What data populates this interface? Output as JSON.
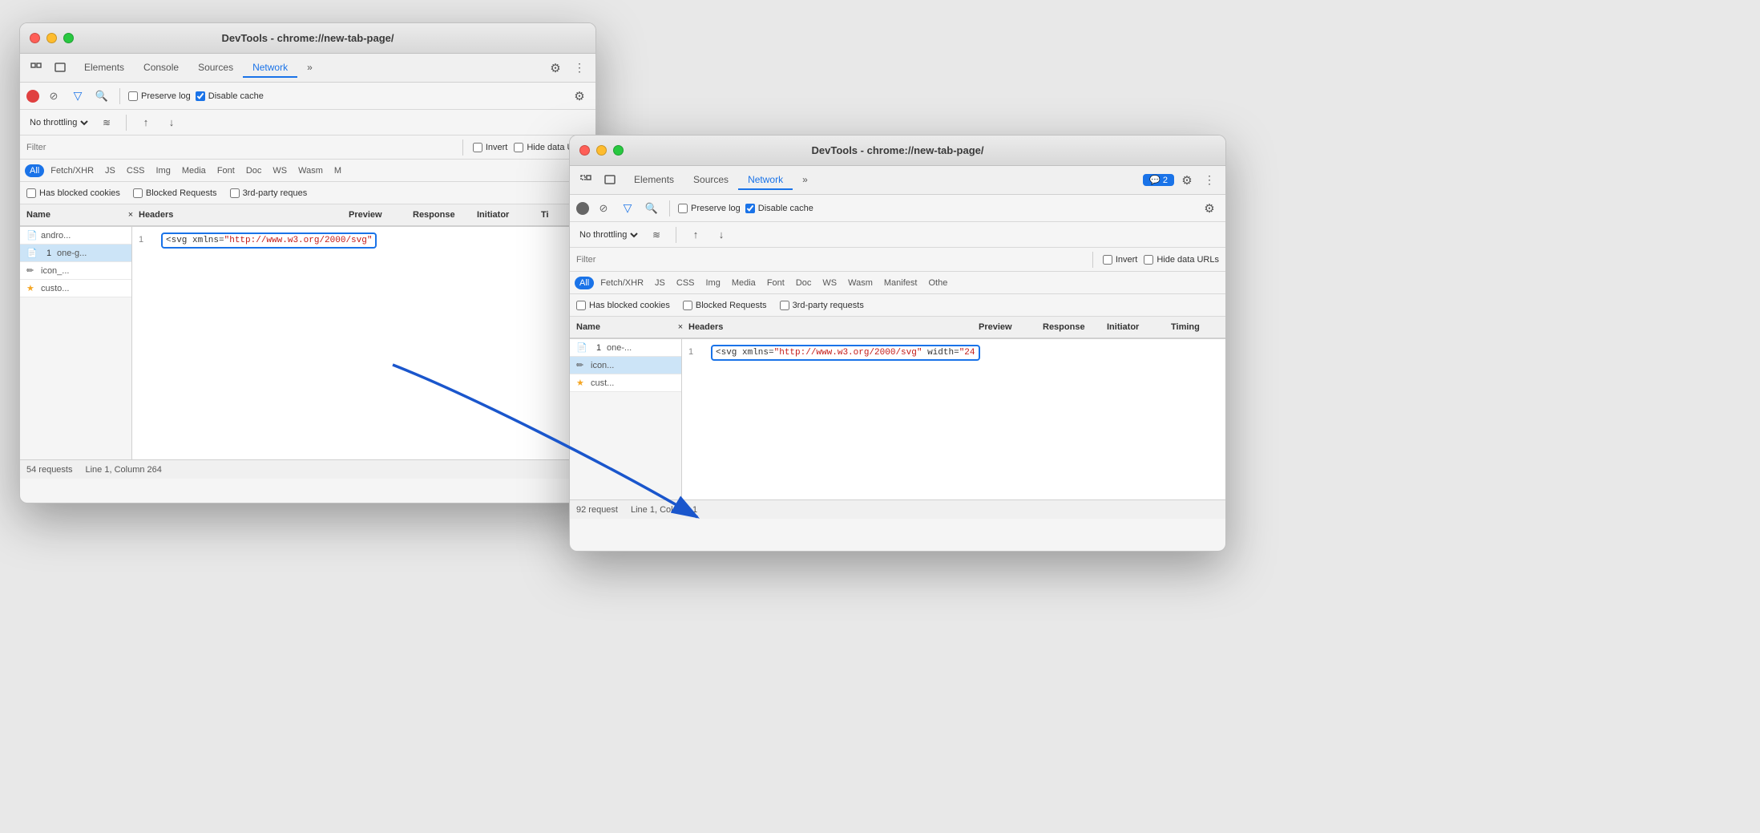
{
  "window1": {
    "title": "DevTools - chrome://new-tab-page/",
    "tabs": [
      {
        "label": "Elements",
        "active": false
      },
      {
        "label": "Console",
        "active": false
      },
      {
        "label": "Sources",
        "active": false
      },
      {
        "label": "Network",
        "active": true
      },
      {
        "label": "»",
        "active": false
      }
    ],
    "network_toolbar": {
      "preserve_log_label": "Preserve log",
      "disable_cache_label": "Disable cache"
    },
    "throttle": "No throttling",
    "filter_placeholder": "Filter",
    "filter_options": {
      "invert": "Invert",
      "hide_data_urls": "Hide data URLs"
    },
    "type_filters": [
      "All",
      "Fetch/XHR",
      "JS",
      "CSS",
      "Img",
      "Media",
      "Font",
      "Doc",
      "WS",
      "Wasm",
      "M"
    ],
    "checkboxes": [
      "Has blocked cookies",
      "Blocked Requests",
      "3rd-party reques"
    ],
    "table_cols": [
      "Name",
      "×",
      "Headers",
      "Preview",
      "Response",
      "Initiator",
      "Ti"
    ],
    "rows": [
      {
        "icon": "page",
        "name": "andro...",
        "num": "",
        "type": "page"
      },
      {
        "icon": "doc",
        "name": "one-g...",
        "num": "1",
        "type": "doc"
      },
      {
        "icon": "edit",
        "name": "icon_...",
        "num": "",
        "type": "icon"
      },
      {
        "icon": "star",
        "name": "custo...",
        "num": "",
        "type": "custom"
      }
    ],
    "selected_row": "one-g...",
    "response_content": "<svg xmlns=\"http://www.w3.org/2000/svg\"",
    "status_bar": {
      "requests": "54 requests",
      "position": "Line 1, Column 264"
    }
  },
  "window2": {
    "title": "DevTools - chrome://new-tab-page/",
    "tabs": [
      {
        "label": "Elements",
        "active": false
      },
      {
        "label": "Sources",
        "active": false
      },
      {
        "label": "Network",
        "active": true
      },
      {
        "label": "»",
        "active": false
      }
    ],
    "badge": "2",
    "network_toolbar": {
      "preserve_log_label": "Preserve log",
      "disable_cache_label": "Disable cache"
    },
    "throttle": "No throttling",
    "filter_placeholder": "Filter",
    "filter_options": {
      "invert": "Invert",
      "hide_data_urls": "Hide data URLs"
    },
    "type_filters": [
      "All",
      "Fetch/XHR",
      "JS",
      "CSS",
      "Img",
      "Media",
      "Font",
      "Doc",
      "WS",
      "Wasm",
      "Manifest",
      "Othe"
    ],
    "checkboxes": [
      "Has blocked cookies",
      "Blocked Requests",
      "3rd-party requests"
    ],
    "table_cols": [
      "Name",
      "×",
      "Headers",
      "Preview",
      "Response",
      "Initiator",
      "Timing"
    ],
    "rows": [
      {
        "icon": "doc",
        "name": "one-...",
        "num": "1",
        "type": "doc"
      },
      {
        "icon": "edit",
        "name": "icon...",
        "num": "",
        "type": "icon",
        "selected": true
      },
      {
        "icon": "star",
        "name": "cust...",
        "num": "",
        "type": "custom"
      }
    ],
    "selected_row": "icon...",
    "response_content": "<svg xmlns=\"http://www.w3.org/2000/svg\" width=\"24",
    "status_bar": {
      "requests": "92 request",
      "position": "Line 1, Column 1"
    }
  },
  "icons": {
    "record": "⏺",
    "clear": "🚫",
    "filter": "▽",
    "search": "🔍",
    "gear": "⚙",
    "more": "⋮",
    "inspect": "⬚",
    "device": "□",
    "upload": "↑",
    "download": "↓",
    "wifi": "📶"
  }
}
